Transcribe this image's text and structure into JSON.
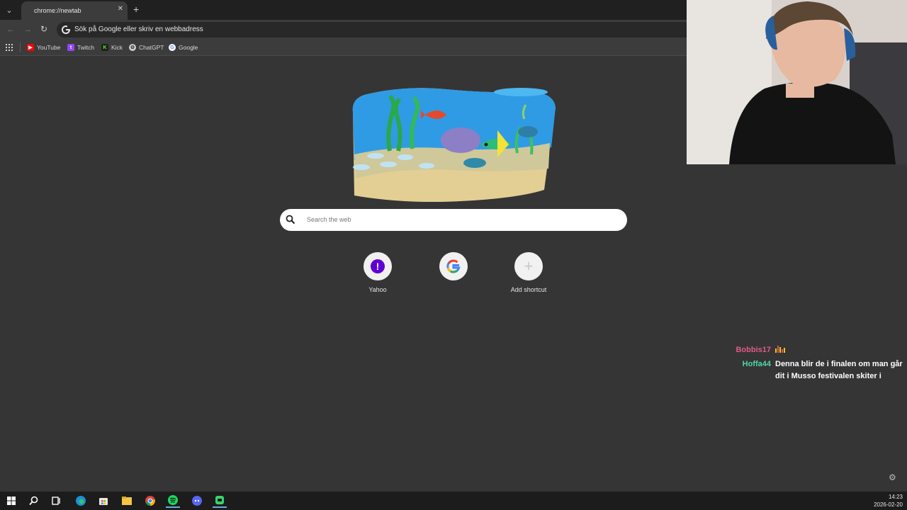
{
  "browser": {
    "tab_title": "chrome://newtab",
    "tab_close": "✕",
    "new_tab": "+",
    "omnibox_placeholder": "Sök på Google eller skriv en webbadress",
    "bookmarks": [
      {
        "label": "YouTube",
        "icon": "youtube-icon",
        "color": "#ff0000"
      },
      {
        "label": "Twitch",
        "icon": "twitch-icon",
        "color": "#9146ff"
      },
      {
        "label": "Kick",
        "icon": "kick-icon",
        "color": "#53fc18"
      },
      {
        "label": "ChatGPT",
        "icon": "chatgpt-icon",
        "color": "#d0d0d0"
      },
      {
        "label": "Google",
        "icon": "google-icon",
        "color": "#4285f4"
      }
    ]
  },
  "newtab": {
    "search_placeholder": "Search the web",
    "shortcuts": [
      {
        "label": "Yahoo",
        "icon": "yahoo-icon"
      },
      {
        "label": "",
        "icon": "google-icon"
      },
      {
        "label": "Add shortcut",
        "icon": "plus-icon"
      }
    ]
  },
  "chat": {
    "messages": [
      {
        "user": "Bobbis17",
        "user_color": "#e05a8a",
        "text": "",
        "badge": "equalizer-emote-icon"
      },
      {
        "user": "Hoffa44",
        "user_color": "#4fd6a8",
        "text": "Denna blir de i finalen om man går dit i Musso festivalen skiter i"
      }
    ]
  },
  "taskbar": {
    "time": "14:23",
    "date": "2026-02-20",
    "icons": [
      "windows-start-icon",
      "search-icon",
      "task-view-icon",
      "edge-icon",
      "store-icon",
      "file-explorer-icon",
      "chrome-icon",
      "spotify-icon",
      "discord-icon",
      "app-icon"
    ]
  },
  "colors": {
    "page_bg": "#353535",
    "toolbar_bg": "#3c3c3c",
    "tabstrip_bg": "#202020",
    "taskbar_bg": "#1c1c1c"
  }
}
